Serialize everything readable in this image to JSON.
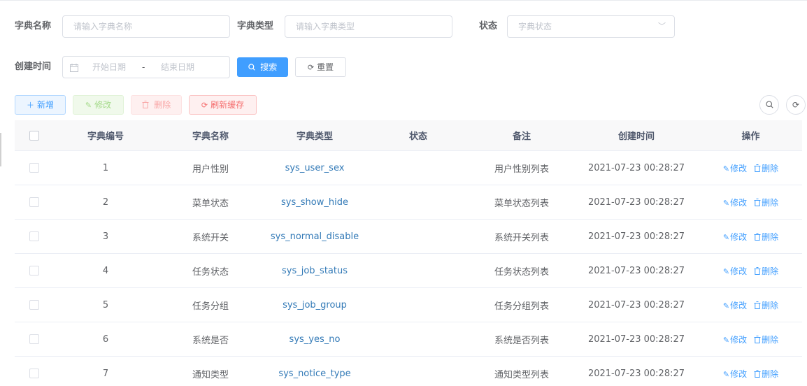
{
  "form": {
    "dict_name_label": "字典名称",
    "dict_name_placeholder": "请输入字典名称",
    "dict_type_label": "字典类型",
    "dict_type_placeholder": "请输入字典类型",
    "status_label": "状态",
    "status_placeholder": "字典状态",
    "create_time_label": "创建时间",
    "start_date_placeholder": "开始日期",
    "date_separator": "-",
    "end_date_placeholder": "结束日期",
    "search_label": "搜索",
    "reset_label": "重置"
  },
  "toolbar": {
    "add_label": "新增",
    "edit_label": "修改",
    "delete_label": "删除",
    "refresh_cache_label": "刷新缓存"
  },
  "table": {
    "headers": [
      "字典编号",
      "字典名称",
      "字典类型",
      "状态",
      "备注",
      "创建时间",
      "操作"
    ],
    "rows": [
      {
        "id": "1",
        "name": "用户性别",
        "type": "sys_user_sex",
        "status": "",
        "remark": "用户性别列表",
        "created": "2021-07-23 00:28:27"
      },
      {
        "id": "2",
        "name": "菜单状态",
        "type": "sys_show_hide",
        "status": "",
        "remark": "菜单状态列表",
        "created": "2021-07-23 00:28:27"
      },
      {
        "id": "3",
        "name": "系统开关",
        "type": "sys_normal_disable",
        "status": "",
        "remark": "系统开关列表",
        "created": "2021-07-23 00:28:27"
      },
      {
        "id": "4",
        "name": "任务状态",
        "type": "sys_job_status",
        "status": "",
        "remark": "任务状态列表",
        "created": "2021-07-23 00:28:27"
      },
      {
        "id": "5",
        "name": "任务分组",
        "type": "sys_job_group",
        "status": "",
        "remark": "任务分组列表",
        "created": "2021-07-23 00:28:27"
      },
      {
        "id": "6",
        "name": "系统是否",
        "type": "sys_yes_no",
        "status": "",
        "remark": "系统是否列表",
        "created": "2021-07-23 00:28:27"
      },
      {
        "id": "7",
        "name": "通知类型",
        "type": "sys_notice_type",
        "status": "",
        "remark": "通知类型列表",
        "created": "2021-07-23 00:28:27"
      }
    ],
    "row_edit_label": "修改",
    "row_delete_label": "删除"
  }
}
